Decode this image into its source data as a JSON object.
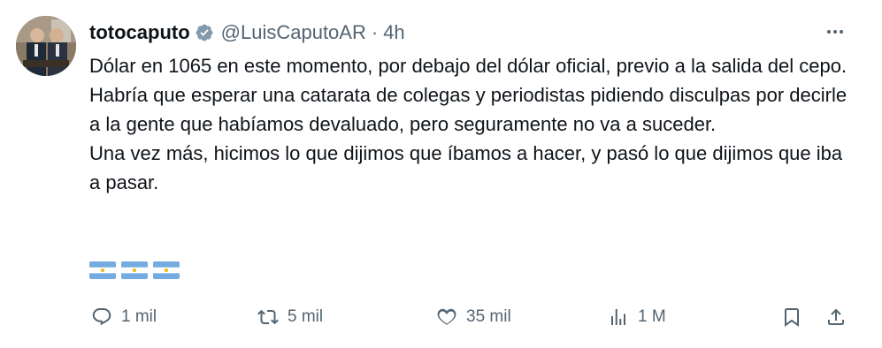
{
  "author": {
    "display_name": "totocaputo",
    "verified": true,
    "handle": "@LuisCaputoAR",
    "separator": "·",
    "time": "4h"
  },
  "tweet": {
    "paragraphs": [
      "Dólar en 1065 en este momento, por debajo del dólar oficial, previo a la salida del cepo.",
      "Habría que esperar una catarata de colegas y periodistas pidiendo disculpas por decirle a la gente que habíamos devaluado, pero seguramente no va a suceder.",
      "Una vez más, hicimos lo que dijimos que íbamos a hacer, y pasó lo que dijimos que iba a pasar."
    ],
    "emoji": [
      "argentina-flag",
      "argentina-flag",
      "argentina-flag"
    ]
  },
  "actions": {
    "replies": "1 mil",
    "reposts": "5 mil",
    "likes": "35 mil",
    "views": "1 M"
  },
  "colors": {
    "text": "#0f1419",
    "secondary": "#536471",
    "verified": "#829aab",
    "flag_blue": "#74acdf",
    "flag_sun": "#f6b40e"
  },
  "icons": {
    "more": "more-dots-icon",
    "reply": "reply-icon",
    "retweet": "retweet-icon",
    "like": "heart-icon",
    "views": "views-chart-icon",
    "bookmark": "bookmark-icon",
    "share": "share-icon"
  }
}
